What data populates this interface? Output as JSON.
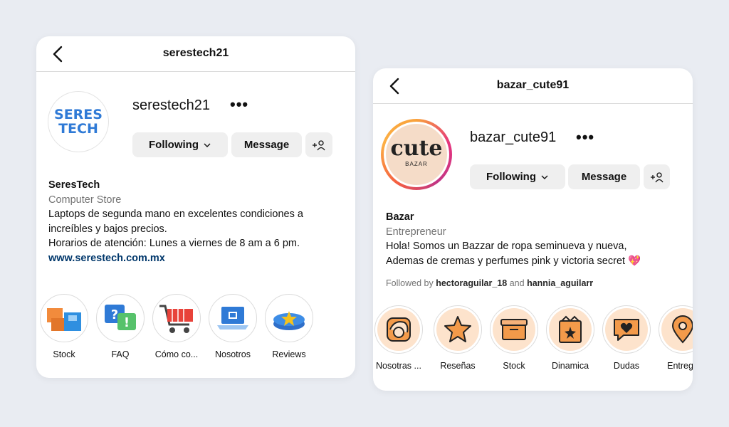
{
  "profile1": {
    "header_title": "serestech21",
    "username": "serestech21",
    "logo_text_line1": "SERES",
    "logo_text_line2": "TECH",
    "following_label": "Following",
    "message_label": "Message",
    "bio_name": "SeresTech",
    "bio_category": "Computer Store",
    "bio_line1": "Laptops de segunda mano en excelentes condiciones a",
    "bio_line2": "increíbles y bajos precios.",
    "bio_line3": "Horarios de atención: Lunes a viernes de 8 am a 6 pm.",
    "bio_link": "www.serestech.com.mx",
    "highlights": [
      {
        "label": "Stock",
        "icon": "boxes-icon"
      },
      {
        "label": "FAQ",
        "icon": "faq-icon"
      },
      {
        "label": "Cómo co...",
        "icon": "shopping-cart-icon"
      },
      {
        "label": "Nosotros",
        "icon": "laptop-icon"
      },
      {
        "label": "Reviews",
        "icon": "star-badge-icon"
      }
    ]
  },
  "profile2": {
    "header_title": "bazar_cute91",
    "username": "bazar_cute91",
    "logo_text_main": "cute",
    "logo_text_sub": "BAZAR",
    "following_label": "Following",
    "message_label": "Message",
    "bio_name": "Bazar",
    "bio_category": "Entrepreneur",
    "bio_line1": "Hola! Somos un Bazzar de ropa seminueva y nueva,",
    "bio_line2": "Ademas de cremas y perfumes pink y victoria secret",
    "bio_emoji": "💖",
    "followed_prefix": "Followed by",
    "followed_user1": "hectoraguilar_18",
    "followed_and": "and",
    "followed_user2": "hannia_aguilarr",
    "highlights": [
      {
        "label": "Nosotras ...",
        "icon": "face-icon"
      },
      {
        "label": "Reseñas",
        "icon": "star-icon"
      },
      {
        "label": "Stock",
        "icon": "box-icon"
      },
      {
        "label": "Dinamica",
        "icon": "gift-icon"
      },
      {
        "label": "Dudas",
        "icon": "heart-chat-icon"
      },
      {
        "label": "Entrega",
        "icon": "location-pin-icon"
      }
    ]
  },
  "colors": {
    "background": "#e9ecf2",
    "button_bg": "#efefef",
    "link_color": "#00376b",
    "muted_text": "#737373",
    "seres_blue": "#2f7ad6",
    "highlight_peach": "#fde3cc",
    "cute_orange": "#f39a4a"
  }
}
